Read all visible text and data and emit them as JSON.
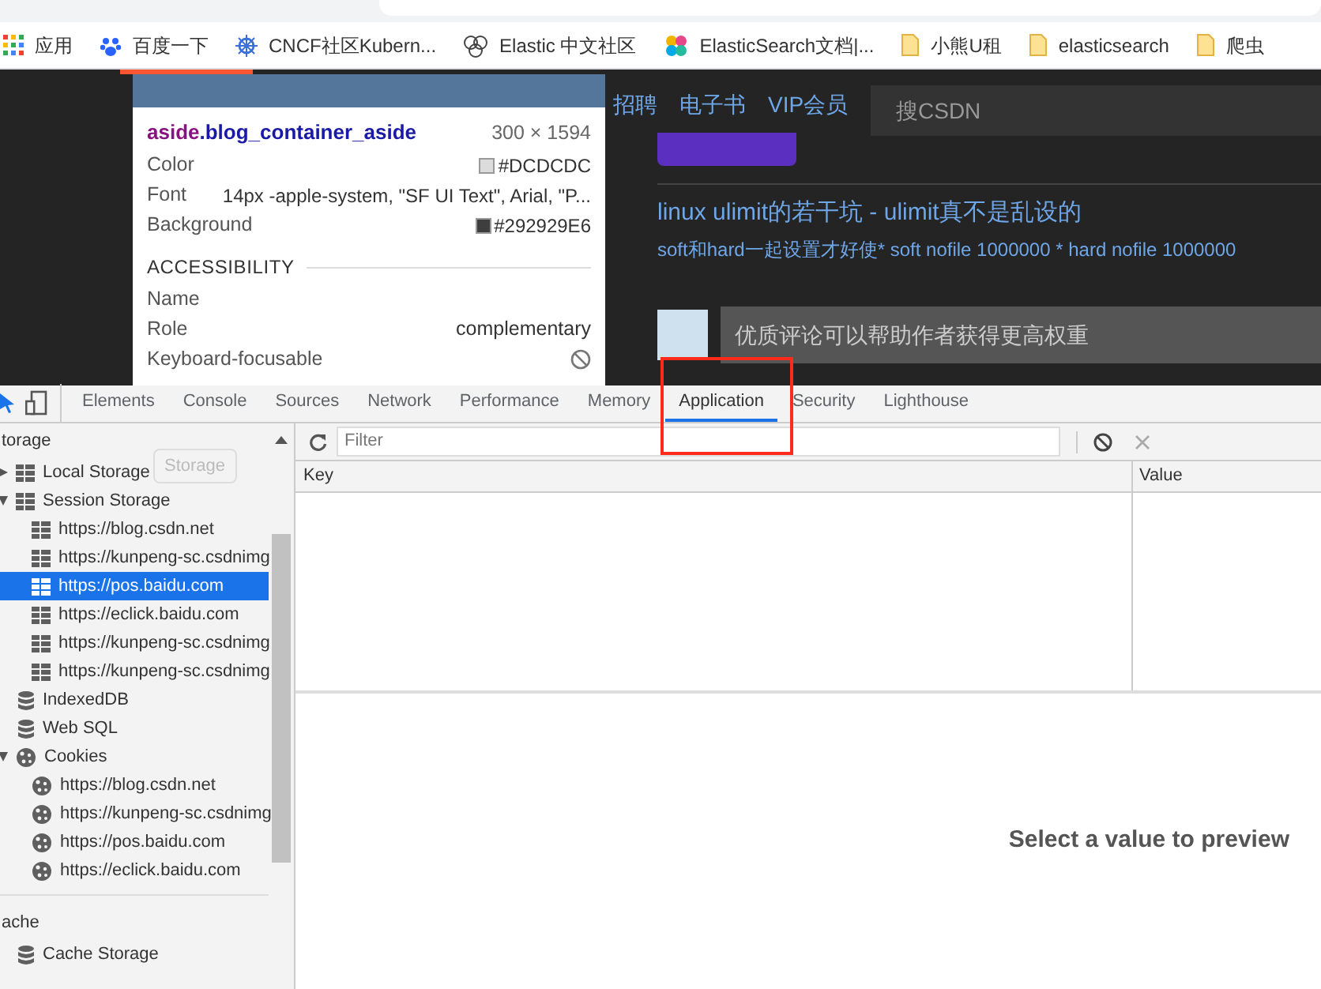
{
  "bookmarks": [
    {
      "label": "应用",
      "kind": "apps"
    },
    {
      "label": "百度一下",
      "kind": "paw"
    },
    {
      "label": "CNCF社区Kubern...",
      "kind": "wheel"
    },
    {
      "label": "Elastic 中文社区",
      "kind": "circles"
    },
    {
      "label": "ElasticSearch文档|...",
      "kind": "dots"
    },
    {
      "label": "小熊U租",
      "kind": "folder"
    },
    {
      "label": "elasticsearch",
      "kind": "folder"
    },
    {
      "label": "爬虫",
      "kind": "folder"
    }
  ],
  "page": {
    "nav": [
      "招聘",
      "电子书",
      "VIP会员"
    ],
    "search_placeholder": "搜CSDN",
    "article_title": "linux ulimit的若干坑 - ulimit真不是乱设的",
    "article_summary": "soft和hard一起设置才好使* soft nofile 1000000 * hard nofile 1000000",
    "comment_placeholder": "优质评论可以帮助作者获得更高权重"
  },
  "inspect_tooltip": {
    "selector_tag": "aside",
    "selector_class": ".blog_container_aside",
    "size": "300 × 1594",
    "rows": [
      {
        "label": "Color",
        "value": "#DCDCDC",
        "kind": "color"
      },
      {
        "label": "Font",
        "value": "14px -apple-system, \"SF UI Text\", Arial, \"P...",
        "kind": "text"
      },
      {
        "label": "Background",
        "value": "#292929E6",
        "kind": "color"
      }
    ],
    "section": "ACCESSIBILITY",
    "a11y": [
      {
        "label": "Name",
        "kind": "empty"
      },
      {
        "label": "Role",
        "value": "complementary",
        "kind": "text"
      },
      {
        "label": "Keyboard-focusable",
        "kind": "blocked"
      }
    ]
  },
  "devtools": {
    "tabs": [
      {
        "label": "Elements",
        "selected": false
      },
      {
        "label": "Console",
        "selected": false
      },
      {
        "label": "Sources",
        "selected": false
      },
      {
        "label": "Network",
        "selected": false
      },
      {
        "label": "Performance",
        "selected": false
      },
      {
        "label": "Memory",
        "selected": false
      },
      {
        "label": "Application",
        "selected": true
      },
      {
        "label": "Security",
        "selected": false
      },
      {
        "label": "Lighthouse",
        "selected": false
      }
    ],
    "sidebar": {
      "sections": [
        {
          "title": "torage",
          "items": [
            {
              "label": "Local Storage",
              "kind": "grid",
              "expanded": false,
              "selected": false
            },
            {
              "label": "Session Storage",
              "kind": "grid",
              "expanded": true,
              "selected": false,
              "children": [
                {
                  "label": "https://blog.csdn.net",
                  "kind": "grid",
                  "selected": false
                },
                {
                  "label": "https://kunpeng-sc.csdnimg",
                  "kind": "grid",
                  "selected": false
                },
                {
                  "label": "https://pos.baidu.com",
                  "kind": "grid",
                  "selected": true
                },
                {
                  "label": "https://eclick.baidu.com",
                  "kind": "grid",
                  "selected": false
                },
                {
                  "label": "https://kunpeng-sc.csdnimg",
                  "kind": "grid",
                  "selected": false
                },
                {
                  "label": "https://kunpeng-sc.csdnimg",
                  "kind": "grid",
                  "selected": false
                }
              ]
            },
            {
              "label": "IndexedDB",
              "kind": "db",
              "selected": false
            },
            {
              "label": "Web SQL",
              "kind": "db",
              "selected": false
            },
            {
              "label": "Cookies",
              "kind": "cookie",
              "expanded": true,
              "selected": false,
              "children": [
                {
                  "label": "https://blog.csdn.net",
                  "kind": "cookie",
                  "selected": false
                },
                {
                  "label": "https://kunpeng-sc.csdnimg",
                  "kind": "cookie",
                  "selected": false
                },
                {
                  "label": "https://pos.baidu.com",
                  "kind": "cookie",
                  "selected": false
                },
                {
                  "label": "https://eclick.baidu.com",
                  "kind": "cookie",
                  "selected": false
                }
              ]
            }
          ]
        },
        {
          "title": "ache",
          "items": [
            {
              "label": "Cache Storage",
              "kind": "db",
              "selected": false
            }
          ]
        }
      ],
      "hover_tip": "Storage"
    },
    "filter_placeholder": "Filter",
    "columns": [
      "Key",
      "Value"
    ],
    "preview_message": "Select a value to preview"
  }
}
